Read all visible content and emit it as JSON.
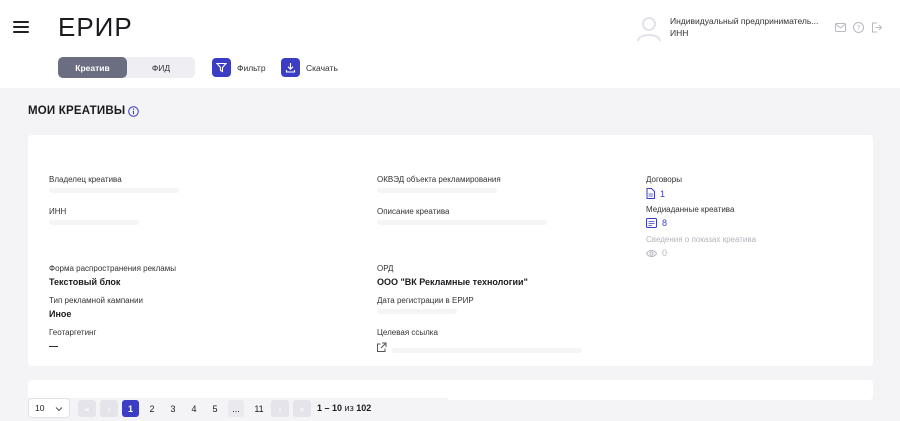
{
  "header": {
    "logo": "ЕРИР",
    "user_name": "Индивидуальный предприниматель...",
    "user_inn": "ИНН"
  },
  "tabs": {
    "creative": "Креатив",
    "feed": "ФИД"
  },
  "actions": {
    "filter": "Фильтр",
    "download": "Скачать"
  },
  "section": {
    "title": "МОИ КРЕАТИВЫ"
  },
  "card": {
    "owner_label": "Владелец креатива",
    "inn_label": "ИНН",
    "distribution_label": "Форма распространения рекламы",
    "distribution_value": "Текстовый блок",
    "campaign_type_label": "Тип рекламной кампании",
    "campaign_type_value": "Иное",
    "geo_label": "Геотаргетинг",
    "geo_value": "—",
    "okved_label": "ОКВЭД объекта рекламирования",
    "description_label": "Описание креатива",
    "ord_label": "ОРД",
    "ord_value": "ООО \"ВК Рекламные технологии\"",
    "reg_date_label": "Дата регистрации в ЕРИР",
    "target_link_label": "Целевая ссылка",
    "contracts_label": "Договоры",
    "contracts_count": "1",
    "media_label": "Медиаданные креатива",
    "media_count": "8",
    "impressions_label": "Сведения о показах креатива",
    "impressions_count": "0"
  },
  "pagination": {
    "page_size": "10",
    "pages": [
      "1",
      "2",
      "3",
      "4",
      "5",
      "...",
      "11"
    ],
    "current_page": "1",
    "range_text": "1 – 10",
    "range_of": "из",
    "total": "102"
  },
  "colors": {
    "accent": "#3b3ec5",
    "toggle_active": "#6b6e80",
    "background": "#f4f4f7"
  }
}
